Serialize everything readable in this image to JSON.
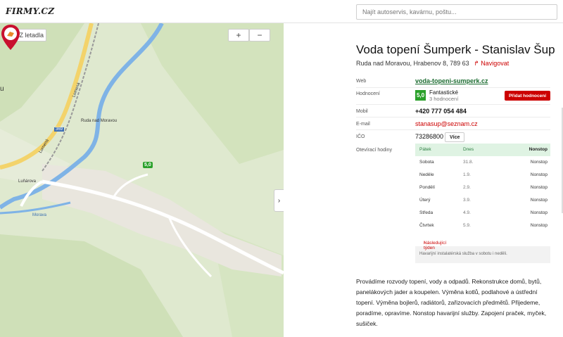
{
  "header": {
    "logo": "FIRMY.CZ",
    "search_placeholder": "Najít autoservis, kavárnu, poštu..."
  },
  "map": {
    "airports_label": "Z letadla",
    "zoom_in": "+",
    "zoom_out": "−",
    "collapse_glyph": "›",
    "labels": {
      "lomena1": "Lomená",
      "lomena2": "Lomená",
      "lunarova": "Luňárova",
      "town": "Ruda nad Moravou",
      "road": "369",
      "river": "Morava",
      "edge": "u"
    },
    "pin_rating": "5,0"
  },
  "business": {
    "title": "Voda topení Šumperk - Stanislav Šup",
    "address": "Ruda nad Moravou, Hrabenov 8, 789 63",
    "navigate": "Navigovat",
    "navigate_icon": "↱",
    "web_label": "Web",
    "web_value": "voda-topeni-sumperk.cz",
    "rating_label": "Hodnocení",
    "rating_score": "5,0",
    "rating_word": "Fantastické",
    "rating_count": "3 hodnocení",
    "add_rating": "Přidat hodnocení",
    "phone_label": "Mobil",
    "phone_value": "+420 777 054 484",
    "email_label": "E-mail",
    "email_value": "stanasup@seznam.cz",
    "ico_label": "IČO",
    "ico_value": "73286800",
    "more_label": "Více",
    "hours_label": "Otevírací hodiny",
    "hours": [
      {
        "day": "Pátek",
        "date": "Dnes",
        "time": "Nonstop"
      },
      {
        "day": "Sobota",
        "date": "31.8.",
        "time": "Nonstop"
      },
      {
        "day": "Neděle",
        "date": "1.9.",
        "time": "Nonstop"
      },
      {
        "day": "Pondělí",
        "date": "2.9.",
        "time": "Nonstop"
      },
      {
        "day": "Úterý",
        "date": "3.9.",
        "time": "Nonstop"
      },
      {
        "day": "Středa",
        "date": "4.9.",
        "time": "Nonstop"
      },
      {
        "day": "Čtvrtek",
        "date": "5.9.",
        "time": "Nonstop"
      }
    ],
    "next_week": "Následující týden",
    "next_icon": "›",
    "hours_note": "Havarijní instalatérská služba v sobotu i neděli.",
    "description": "Provádíme rozvody topení, vody a odpadů. Rekonstrukce domů, bytů, panelákových jader a koupelen. Výměna kotlů, podlahové a ústřední topení. Výměna bojlerů, radiátorů, zařizovacích předmětů. Přijedeme, poradíme, opravíme. Nonstop havarijní služby. Zapojení praček, myček, sušiček."
  }
}
